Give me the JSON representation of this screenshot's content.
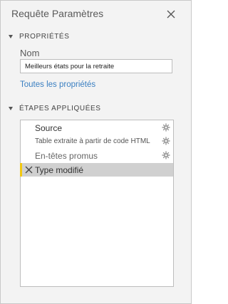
{
  "pane": {
    "title": "Requête Paramètres"
  },
  "properties": {
    "header": "PROPRIÉTÉS",
    "name_label": "Nom",
    "name_value": "Meilleurs états pour la retraite",
    "all_properties_link": "Toutes les propriétés"
  },
  "applied_steps": {
    "header": "ÉTAPES APPLIQUÉES",
    "items": [
      {
        "label": "Source",
        "has_settings": true,
        "selected": false
      },
      {
        "label": "Table extraite à partir de code HTML",
        "has_settings": true,
        "selected": false
      },
      {
        "label": "En-têtes promus",
        "has_settings": true,
        "selected": false
      },
      {
        "label": "Type modifié",
        "has_settings": false,
        "selected": true
      }
    ]
  },
  "colors": {
    "accent_selected_bar": "#f2c811",
    "link": "#3a7fc1",
    "selected_row": "#d0d0d0"
  },
  "icons": {
    "close": "close-icon",
    "section_toggle": "collapse-triangle-icon",
    "step_settings": "gear-icon",
    "step_delete": "delete-x-icon"
  }
}
